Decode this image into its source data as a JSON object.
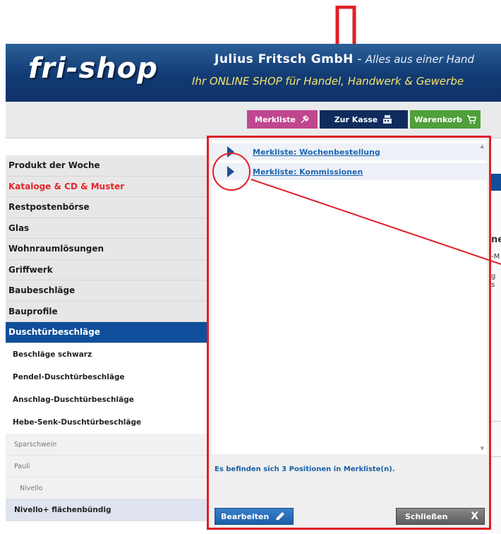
{
  "header": {
    "logo": "fri-shop",
    "company_name": "Julius Fritsch GmbH",
    "company_sep": " - ",
    "company_tagline": "Alles aus einer Hand",
    "slogan": "Ihr ONLINE SHOP für Handel, Handwerk & Gewerbe"
  },
  "nav": {
    "merkliste": "Merkliste",
    "kasse": "Zur Kasse",
    "warenkorb": "Warenkorb"
  },
  "sidebar": {
    "categories": [
      {
        "label": "Produkt der Woche"
      },
      {
        "label": "Kataloge & CD & Muster"
      },
      {
        "label": "Restpostenbörse"
      },
      {
        "label": "Glas"
      },
      {
        "label": "Wohnraumlösungen"
      },
      {
        "label": "Griffwerk"
      },
      {
        "label": "Baubeschläge"
      },
      {
        "label": "Bauprofile"
      },
      {
        "label": "Duschtürbeschläge"
      }
    ],
    "subcategories": [
      {
        "label": "Beschläge schwarz"
      },
      {
        "label": "Pendel-Duschtürbeschläge"
      },
      {
        "label": "Anschlag-Duschtürbeschläge"
      },
      {
        "label": "Hebe-Senk-Duschtürbeschläge"
      }
    ],
    "subsub": [
      {
        "label": "Sparschwein"
      },
      {
        "label": "Pauli"
      },
      {
        "label": "Nivello"
      },
      {
        "label": "Nivello+ flächenbündig"
      }
    ]
  },
  "right_fragments": {
    "a": "ne",
    "b": "-M",
    "c": "g",
    "d": "s"
  },
  "popup": {
    "lists": [
      {
        "label": "Merkliste: Wochenbestellung"
      },
      {
        "label": "Merkliste: Kommissionen"
      }
    ],
    "status": "Es befinden sich 3 Positionen in Merkliste(n).",
    "edit_label": "Bearbeiten",
    "close_label": "Schließen",
    "close_x": "X"
  },
  "colors": {
    "highlight_red": "#e11f26",
    "brand_blue": "#0f4e9a",
    "merkliste_pink": "#c0478f",
    "kasse_navy": "#102c5c",
    "warenkorb_green": "#4f9f3a"
  }
}
